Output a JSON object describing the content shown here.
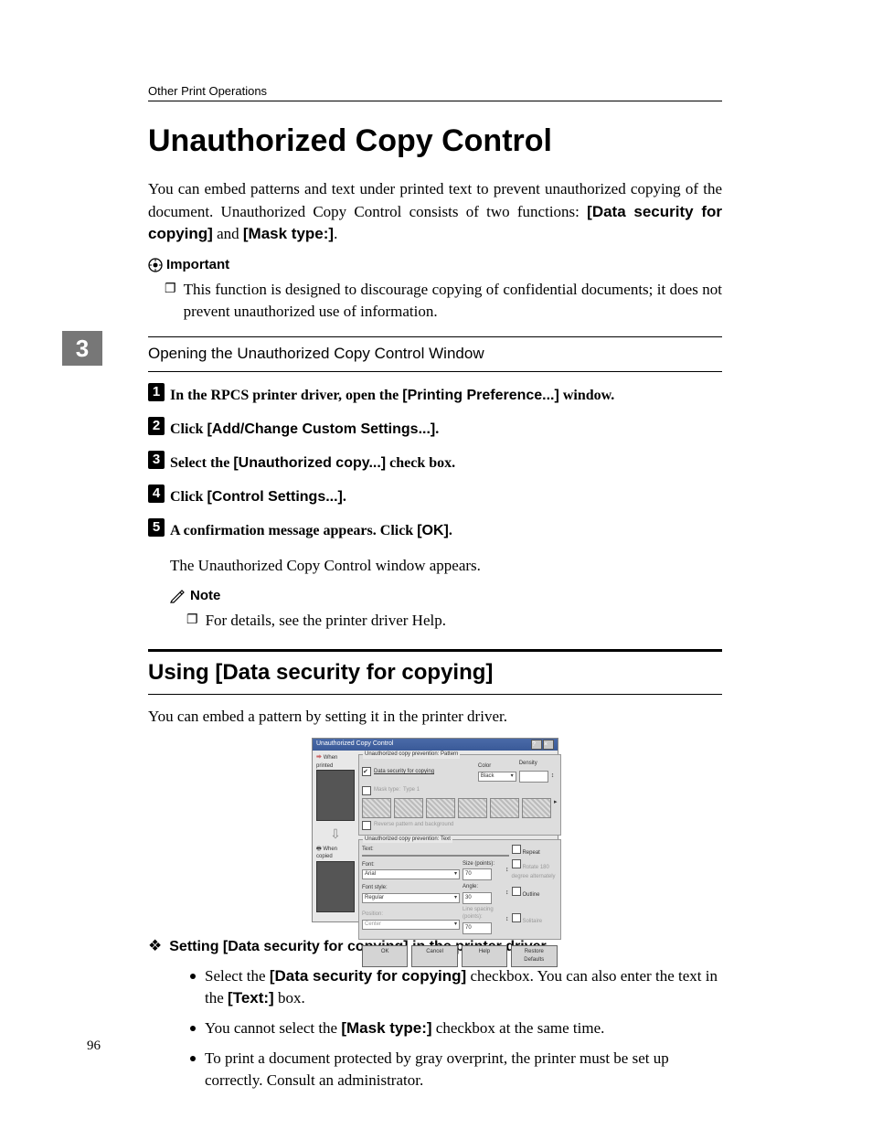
{
  "header": "Other Print Operations",
  "title": "Unauthorized Copy Control",
  "chapter_tab": "3",
  "intro_1": "You can embed patterns and text under printed text to prevent unauthorized copying of the document. Unauthorized Copy Control consists of two functions: ",
  "intro_bold_1": "[Data security for copying]",
  "intro_mid": " and ",
  "intro_bold_2": "[Mask type:]",
  "intro_end": ".",
  "important_label": "Important",
  "important_item": "This function is designed to discourage copying of confidential documents; it does not prevent unauthorized use of information.",
  "opening_heading": "Opening the Unauthorized Copy Control Window",
  "steps": [
    {
      "lead_a": "In the RPCS printer driver, open the ",
      "bold": "[Printing Preference...]",
      "lead_b": " window."
    },
    {
      "lead_a": "Click ",
      "bold": "[Add/Change Custom Settings...]",
      "lead_b": "."
    },
    {
      "lead_a": "Select the ",
      "bold": "[Unauthorized copy...]",
      "lead_b": " check box."
    },
    {
      "lead_a": "Click ",
      "bold": "[Control Settings...]",
      "lead_b": "."
    },
    {
      "lead_a": "A confirmation message appears. Click ",
      "bold": "[OK]",
      "lead_b": "."
    }
  ],
  "step5_sub": "The Unauthorized Copy Control window appears.",
  "note_label": "Note",
  "note_item": "For details, see the printer driver Help.",
  "h2": "Using [Data security for copying]",
  "h2_sub": "You can embed a pattern by setting it in the printer driver.",
  "screenshot": {
    "title": "Unauthorized Copy Control",
    "left_top": "When printed",
    "left_bot": "When copied",
    "fs1_legend": "Unauthorized copy prevention: Pattern",
    "cb_data_sec": "Data security for copying",
    "cb_mask": "Mask type:",
    "mask_val": "Type 1",
    "color_lbl": "Color",
    "color_val": "Black",
    "density_lbl": "Density",
    "cb_reverse": "Reverse pattern and background",
    "fs2_legend": "Unauthorized copy prevention: Text",
    "text_lbl": "Text:",
    "cb_repeat": "Repeat",
    "font_lbl": "Font:",
    "font_val": "Arial",
    "size_lbl": "Size (points):",
    "size_val": "70",
    "style_lbl": "Font style:",
    "style_val": "Regular",
    "angle_lbl": "Angle:",
    "angle_val": "30",
    "pos_lbl": "Position:",
    "pos_val": "Center",
    "line_lbl": "Line spacing (points):",
    "line_val": "70",
    "cb_rotate": "Rotate 180 degree alternately",
    "cb_outline": "Outline",
    "cb_solitaire": "Solitaire",
    "btn_ok": "OK",
    "btn_cancel": "Cancel",
    "btn_help": "Help",
    "btn_restore": "Restore Defaults"
  },
  "setting_heading": "Setting [Data security for copying] in the printer driver",
  "bullets": [
    {
      "pre": "Select the ",
      "b1": "[Data security for copying]",
      "mid": " checkbox. You can also enter the text in the ",
      "b2": "[Text:]",
      "post": " box."
    },
    {
      "pre": "You cannot select the ",
      "b1": "[Mask type:]",
      "mid": " checkbox at the same time.",
      "b2": "",
      "post": ""
    },
    {
      "pre": "To print a document protected by gray overprint, the printer must be set up correctly. Consult an administrator.",
      "b1": "",
      "mid": "",
      "b2": "",
      "post": ""
    }
  ],
  "page_number": "96"
}
